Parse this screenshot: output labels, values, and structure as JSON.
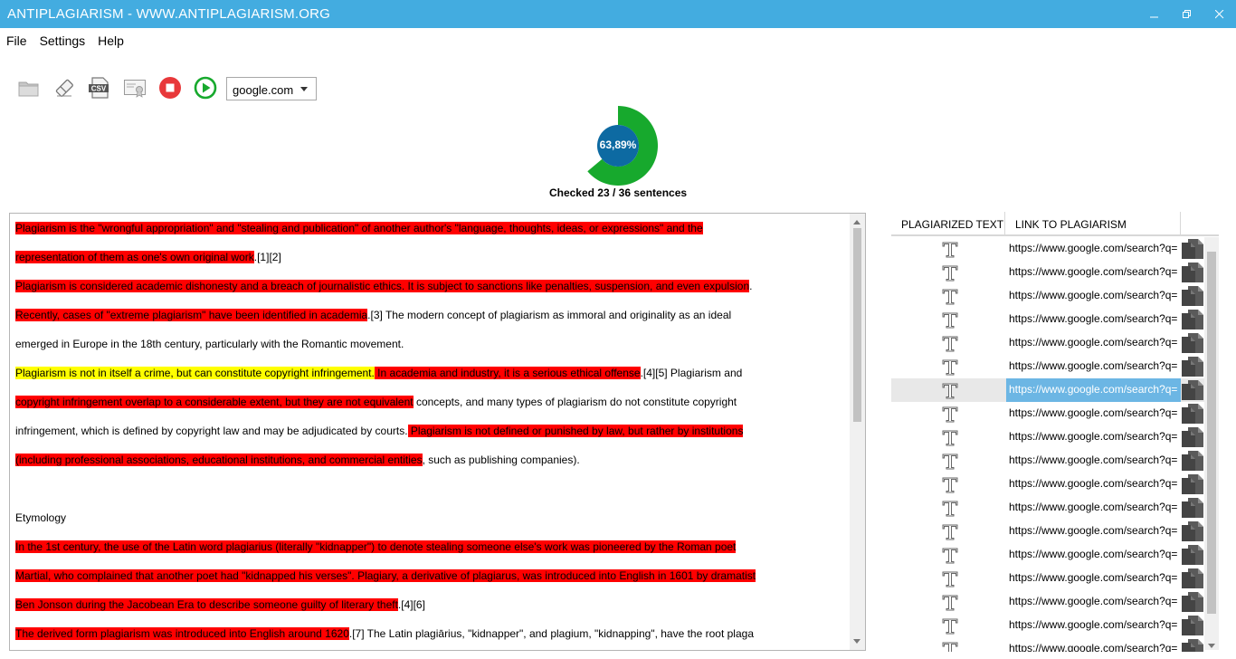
{
  "window": {
    "title": "ANTIPLAGIARISM - WWW.ANTIPLAGIARISM.ORG"
  },
  "menu": [
    "File",
    "Settings",
    "Help"
  ],
  "toolbar": {
    "icons": [
      "open-folder-icon",
      "eraser-icon",
      "csv-export-icon",
      "certificate-icon",
      "stop-icon",
      "play-icon"
    ],
    "search_engine": "google.com"
  },
  "progress": {
    "percent_label": "63,89%",
    "fraction": 0.6389,
    "checked_text": "Checked 23 / 36 sentences",
    "colors": {
      "fill": "#17a92d",
      "center": "#0d6aa2"
    }
  },
  "document": {
    "lines": [
      [
        [
          "r",
          "Plagiarism is the \"wrongful appropriation\" and \"stealing and publication\" of another author's \"language, thoughts, ideas, or expressions\" and the"
        ]
      ],
      [
        [
          "r",
          "representation of them as one's own original work"
        ],
        [
          "n",
          ".[1][2]"
        ]
      ],
      [
        [
          "r",
          "Plagiarism is considered academic dishonesty and a breach of journalistic ethics."
        ],
        [
          "r",
          " It is subject to sanctions like penalties, suspension, and even expulsion"
        ],
        [
          "n",
          "."
        ]
      ],
      [
        [
          "r",
          "Recently, cases of \"extreme plagiarism\" have been identified in academia"
        ],
        [
          "n",
          ".[3] The modern concept of plagiarism as immoral and originality as an ideal"
        ]
      ],
      [
        [
          "n",
          "emerged in Europe in the 18th century, particularly with the Romantic movement."
        ]
      ],
      [
        [
          "y",
          "Plagiarism is not in itself a crime, but can constitute copyright infringement."
        ],
        [
          "r",
          " In academia and industry, it is a serious ethical offense"
        ],
        [
          "n",
          ".[4][5] Plagiarism and"
        ]
      ],
      [
        [
          "r",
          "copyright infringement overlap to a considerable extent, but they are not equivalent"
        ],
        [
          "n",
          " concepts, and many types of plagiarism do not constitute copyright"
        ]
      ],
      [
        [
          "n",
          "infringement, which is defined by copyright law and may be adjudicated by courts."
        ],
        [
          "r",
          " Plagiarism is not defined or punished by law, but rather by institutions"
        ]
      ],
      [
        [
          "r",
          "(including professional associations, educational institutions, and commercial entities"
        ],
        [
          "n",
          ", such as publishing companies)."
        ]
      ],
      [],
      [
        [
          "n",
          "Etymology"
        ]
      ],
      [
        [
          "r",
          "In the 1st century, the use of the Latin word plagiarius (literally \"kidnapper\") to denote stealing someone else's work was pioneered by the Roman poet"
        ]
      ],
      [
        [
          "r",
          "Martial, who complained that another poet had \"kidnapped his verses\"."
        ],
        [
          "r",
          " Plagiary, a derivative of plagiarus, was introduced into English in 1601 by dramatist"
        ]
      ],
      [
        [
          "r",
          "Ben Jonson during the Jacobean Era to describe someone guilty of literary theft"
        ],
        [
          "n",
          ".[4][6]"
        ]
      ],
      [
        [
          "r",
          "The derived form plagiarism was introduced into English around 1620"
        ],
        [
          "n",
          ".[7] The Latin plagiārius, \"kidnapper\", and plagium, \"kidnapping\", have the root plaga"
        ]
      ]
    ]
  },
  "results": {
    "headers": [
      "PLAGIARIZED TEXT",
      "LINK TO PLAGIARISM"
    ],
    "link_text": "https://www.google.com/search?q=",
    "row_count": 18,
    "selected_row": 6
  }
}
